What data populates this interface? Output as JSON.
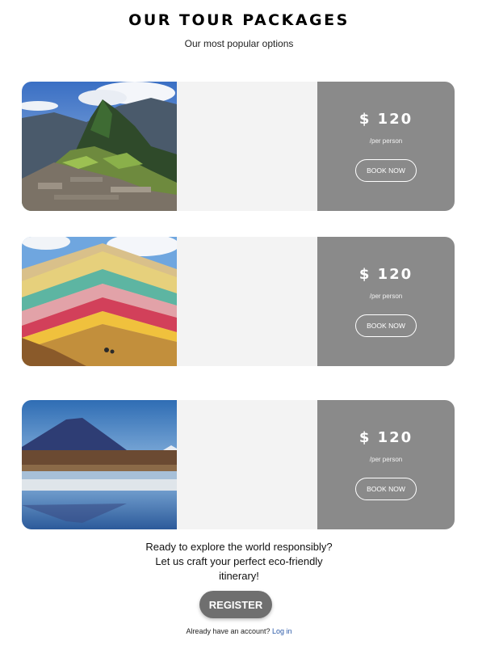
{
  "header": {
    "title": "OUR TOUR PACKAGES",
    "subtitle": "Our most popular options"
  },
  "packages": [
    {
      "image": "machu-picchu-photo",
      "price": "$ 120",
      "per": "/per person",
      "button": "BOOK NOW"
    },
    {
      "image": "rainbow-mountain-photo",
      "price": "$ 120",
      "per": "/per person",
      "button": "BOOK NOW"
    },
    {
      "image": "volcano-lagoon-photo",
      "price": "$ 120",
      "per": "/per person",
      "button": "BOOK NOW"
    }
  ],
  "cta": {
    "line1": "Ready to explore the world responsibly?",
    "line2": "Let us craft your perfect eco-friendly",
    "line3": "itinerary!",
    "register": "REGISTER"
  },
  "login": {
    "prompt": "Already have an account?",
    "link": "Log in"
  },
  "colors": {
    "price_panel": "#8a8a8a",
    "card_background": "#f3f3f3",
    "register_button": "#6f6f6f",
    "link": "#2b5aa8"
  }
}
